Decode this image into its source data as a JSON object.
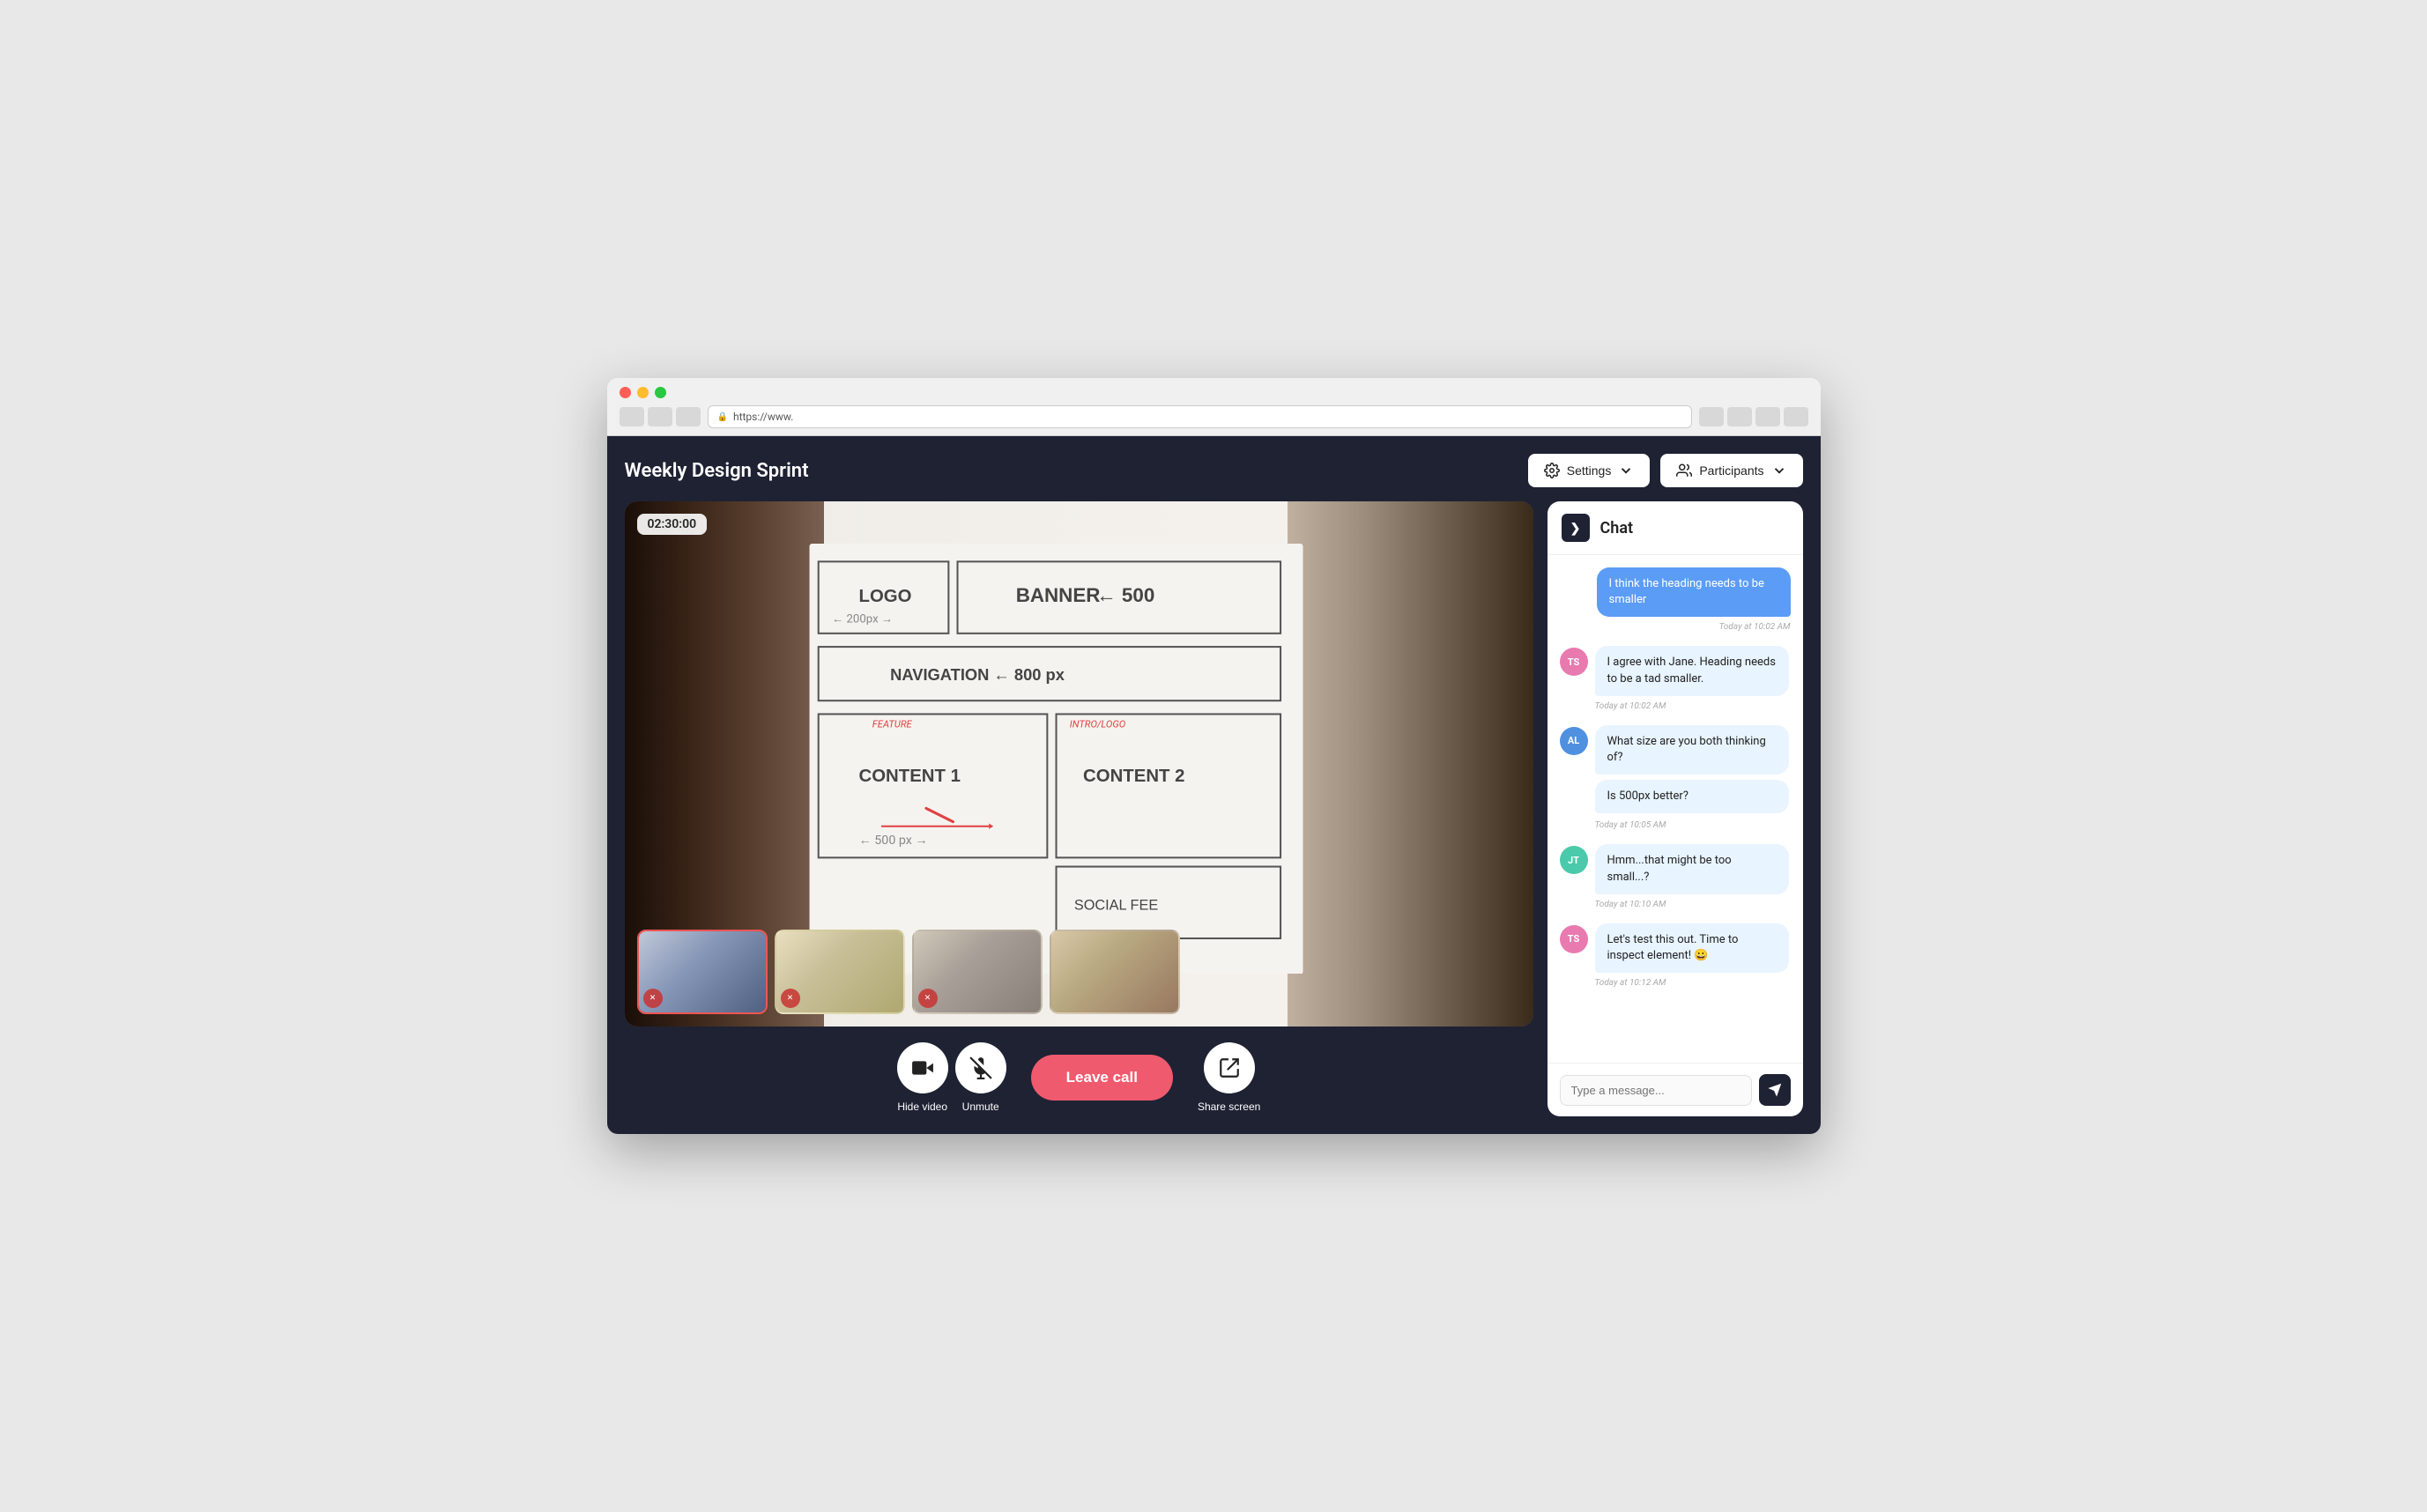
{
  "browser": {
    "address": "https://www.",
    "dot_red": "red",
    "dot_yellow": "yellow",
    "dot_green": "green"
  },
  "meeting": {
    "title": "Weekly Design Sprint",
    "timer": "02:30:00"
  },
  "toolbar": {
    "settings_label": "Settings",
    "participants_label": "Participants"
  },
  "controls": {
    "hide_video_label": "Hide video",
    "unmute_label": "Unmute",
    "share_screen_label": "Share screen",
    "leave_call_label": "Leave call"
  },
  "chat": {
    "title": "Chat",
    "collapse_icon": "❯",
    "messages": [
      {
        "id": 1,
        "type": "own",
        "text": "I think the heading needs to be smaller",
        "time": "Today at 10:02 AM"
      },
      {
        "id": 2,
        "type": "other",
        "avatar": "TS",
        "avatar_color": "av-pink",
        "text": "I agree with Jane. Heading needs to be a tad smaller.",
        "time": "Today at 10:02 AM"
      },
      {
        "id": 3,
        "type": "other",
        "avatar": "AL",
        "avatar_color": "av-blue",
        "text": "What size are you both thinking of?",
        "time": null
      },
      {
        "id": 4,
        "type": "other_same",
        "avatar": "AL",
        "avatar_color": "av-blue",
        "text": "Is 500px better?",
        "time": "Today at 10:05 AM"
      },
      {
        "id": 5,
        "type": "other",
        "avatar": "JT",
        "avatar_color": "av-teal",
        "text": "Hmm...that might be too small...?",
        "time": "Today at 10:10 AM"
      },
      {
        "id": 6,
        "type": "other",
        "avatar": "TS",
        "avatar_color": "av-pink",
        "text": "Let's test this out. Time to inspect element! 😀",
        "time": "Today at 10:12 AM"
      }
    ],
    "input_placeholder": "Type a message..."
  }
}
